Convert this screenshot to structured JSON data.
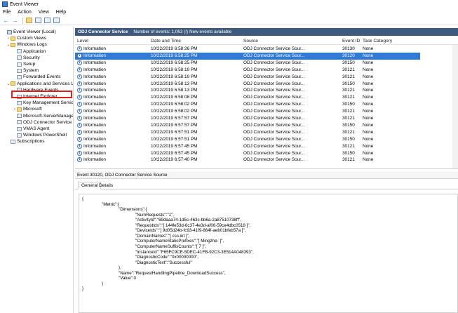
{
  "window": {
    "title": "Event Viewer"
  },
  "menu": [
    "File",
    "Action",
    "View",
    "Help"
  ],
  "tree": [
    {
      "label": "Event Viewer (Local)",
      "level": 0,
      "exp": "",
      "icon": "pc"
    },
    {
      "label": "Custom Views",
      "level": 1,
      "exp": "›",
      "icon": "folder"
    },
    {
      "label": "Windows Logs",
      "level": 1,
      "exp": "⌄",
      "icon": "folder"
    },
    {
      "label": "Application",
      "level": 2,
      "exp": "",
      "icon": "log"
    },
    {
      "label": "Security",
      "level": 2,
      "exp": "",
      "icon": "log"
    },
    {
      "label": "Setup",
      "level": 2,
      "exp": "",
      "icon": "log"
    },
    {
      "label": "System",
      "level": 2,
      "exp": "",
      "icon": "log"
    },
    {
      "label": "Forwarded Events",
      "level": 2,
      "exp": "",
      "icon": "log"
    },
    {
      "label": "Applications and Services Lo",
      "level": 1,
      "exp": "⌄",
      "icon": "folder"
    },
    {
      "label": "Hardware Events",
      "level": 2,
      "exp": "",
      "icon": "log"
    },
    {
      "label": "Internet Explorer",
      "level": 2,
      "exp": "",
      "icon": "log"
    },
    {
      "label": "Key Management Service",
      "level": 2,
      "exp": "",
      "icon": "log"
    },
    {
      "label": "Microsoft",
      "level": 2,
      "exp": "›",
      "icon": "folder"
    },
    {
      "label": "Microsoft-ServerManage",
      "level": 2,
      "exp": "",
      "icon": "log"
    },
    {
      "label": "ODJ Connector Service",
      "level": 2,
      "exp": "",
      "icon": "log"
    },
    {
      "label": "VMAS Agent",
      "level": 2,
      "exp": "",
      "icon": "log"
    },
    {
      "label": "Windows PowerShell",
      "level": 2,
      "exp": "",
      "icon": "log"
    },
    {
      "label": "Subscriptions",
      "level": 1,
      "exp": "",
      "icon": "log"
    }
  ],
  "panel": {
    "name": "ODJ Connector Service",
    "summary": "Number of events: 1,063 (!) New events available"
  },
  "columns": [
    "Level",
    "Date and Time",
    "Source",
    "Event ID",
    "Task Category"
  ],
  "rows": [
    {
      "level": "Information",
      "datetime": "10/22/2019 6:58:26 PM",
      "source": "ODJ Connector Service Sour...",
      "id": "30130",
      "task": "None"
    },
    {
      "level": "Information",
      "datetime": "10/22/2019 6:58:25 PM",
      "source": "ODJ Connector Service Sour...",
      "id": "30120",
      "task": "None"
    },
    {
      "level": "Information",
      "datetime": "10/22/2019 6:58:25 PM",
      "source": "ODJ Connector Service Sour...",
      "id": "30150",
      "task": "None"
    },
    {
      "level": "Information",
      "datetime": "10/22/2019 6:58:19 PM",
      "source": "ODJ Connector Service Sour...",
      "id": "30121",
      "task": "None"
    },
    {
      "level": "Information",
      "datetime": "10/22/2019 6:58:19 PM",
      "source": "ODJ Connector Service Sour...",
      "id": "30121",
      "task": "None"
    },
    {
      "level": "Information",
      "datetime": "10/22/2019 6:58:13 PM",
      "source": "ODJ Connector Service Sour...",
      "id": "30150",
      "task": "None"
    },
    {
      "level": "Information",
      "datetime": "10/22/2019 6:58:13 PM",
      "source": "ODJ Connector Service Sour...",
      "id": "30121",
      "task": "None"
    },
    {
      "level": "Information",
      "datetime": "10/22/2019 6:58:08 PM",
      "source": "ODJ Connector Service Sour...",
      "id": "30121",
      "task": "None"
    },
    {
      "level": "Information",
      "datetime": "10/22/2019 6:58:02 PM",
      "source": "ODJ Connector Service Sour...",
      "id": "30150",
      "task": "None"
    },
    {
      "level": "Information",
      "datetime": "10/22/2019 6:58:02 PM",
      "source": "ODJ Connector Service Sour...",
      "id": "30121",
      "task": "None"
    },
    {
      "level": "Information",
      "datetime": "10/22/2019 6:57:57 PM",
      "source": "ODJ Connector Service Sour...",
      "id": "30121",
      "task": "None"
    },
    {
      "level": "Information",
      "datetime": "10/22/2019 6:57:57 PM",
      "source": "ODJ Connector Service Sour...",
      "id": "30150",
      "task": "None"
    },
    {
      "level": "Information",
      "datetime": "10/22/2019 6:57:51 PM",
      "source": "ODJ Connector Service Sour...",
      "id": "30121",
      "task": "None"
    },
    {
      "level": "Information",
      "datetime": "10/22/2019 6:57:51 PM",
      "source": "ODJ Connector Service Sour...",
      "id": "30150",
      "task": "None"
    },
    {
      "level": "Information",
      "datetime": "10/22/2019 6:57:45 PM",
      "source": "ODJ Connector Service Sour...",
      "id": "30121",
      "task": "None"
    },
    {
      "level": "Information",
      "datetime": "10/22/2019 6:57:45 PM",
      "source": "ODJ Connector Service Sour...",
      "id": "30150",
      "task": "None"
    },
    {
      "level": "Information",
      "datetime": "10/22/2019 6:57:40 PM",
      "source": "ODJ Connector Service Sour...",
      "id": "30121",
      "task": "None"
    }
  ],
  "selected_row": 1,
  "detail": {
    "title": "Event 30120, ODJ Connector Service Source",
    "tabs": [
      "General",
      "Details"
    ],
    "active_tab": 0,
    "json_lines": [
      {
        "indent": 0,
        "text": "{"
      },
      {
        "indent": 1,
        "text": "\"Metric\":{"
      },
      {
        "indent": 2,
        "text": "\"Dimensions\":{"
      },
      {
        "indent": 3,
        "text": "\"NumRequests\":\"1\","
      },
      {
        "indent": 3,
        "text": "\"ActivityId\":\"69daaa74-1d5c-463c-bb6a-2a87510738ff\","
      },
      {
        "indent": 3,
        "text": "\"RequestIds\":\"[ 144fe53d-8c37-4e3d-af06-59ce4dbc0518 ]\","
      },
      {
        "indent": 3,
        "text": "\"DeviceIds\":\"[ 9d05d24b-fc93-41f9-864f-aeb01bfeb57a ]\","
      },
      {
        "indent": 3,
        "text": "\"DomainNames\":\"[ css.int ]\","
      },
      {
        "indent": 3,
        "text": "\"ComputerNameStaticPrefixes\":\"[ Mingzhe- ]\","
      },
      {
        "indent": 3,
        "text": "\"ComputerNameSuffixCounts\":\"[ 7 ]\","
      },
      {
        "indent": 3,
        "text": "\"InstanceId\":\"F65FC9CE-5DEC-41FB-92C3-3E514A048393\","
      },
      {
        "indent": 3,
        "text": "\"DiagnosticCode\":\"0x00000000\","
      },
      {
        "indent": 3,
        "text": "\"DiagnosticText\":\"Successful\""
      },
      {
        "indent": 2,
        "text": "},"
      },
      {
        "indent": 2,
        "text": "\"Name\":\"RequestHandlingPipeline_DownloadSuccess\","
      },
      {
        "indent": 2,
        "text": "\"Value\":0"
      },
      {
        "indent": 1,
        "text": "}"
      },
      {
        "indent": 0,
        "text": "}"
      }
    ]
  },
  "colors": {
    "panel_header": "#3e5b7e",
    "selection": "#2f7ad6",
    "highlight": "#e0201b"
  }
}
